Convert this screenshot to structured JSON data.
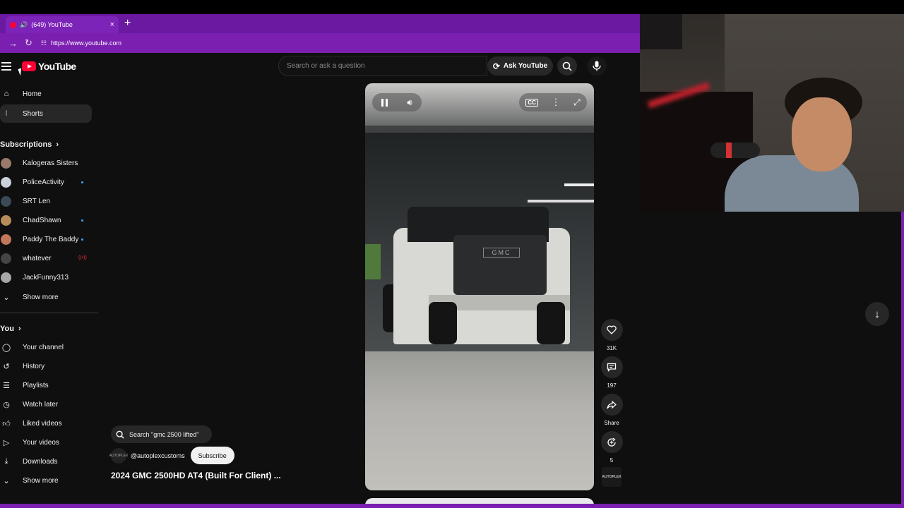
{
  "browser": {
    "tab_title": "(649) YouTube",
    "url": "https://www.youtube.com",
    "new_tab": "+",
    "close": "×"
  },
  "youtube": {
    "logo_text": "YouTube",
    "search": {
      "placeholder": "Search or ask a question"
    },
    "ask_label": "Ask YouTube"
  },
  "sidebar": {
    "main": [
      {
        "label": "Home",
        "icon": "home-icon"
      },
      {
        "label": "Shorts",
        "icon": "shorts-icon",
        "active": true
      }
    ],
    "subscriptions_title": "Subscriptions",
    "subscriptions": [
      {
        "label": "Kalogeras Sisters",
        "color": "#9a7a6a"
      },
      {
        "label": "PoliceActivity",
        "color": "#c9d1da",
        "dot": true
      },
      {
        "label": "SRT Len",
        "color": "#3b4a55"
      },
      {
        "label": "ChadShawn",
        "color": "#b58c5a",
        "dot": true
      },
      {
        "label": "Paddy The Baddy",
        "color": "#c2775c",
        "dot": true
      },
      {
        "label": "whatever",
        "color": "#444444",
        "live": "((•))"
      },
      {
        "label": "JackFunny313",
        "color": "#a7a7a7"
      }
    ],
    "show_more_1": "Show more",
    "you_title": "You",
    "you": [
      {
        "label": "Your channel",
        "icon": "your-channel-icon"
      },
      {
        "label": "History",
        "icon": "history-icon"
      },
      {
        "label": "Playlists",
        "icon": "playlists-icon"
      },
      {
        "label": "Watch later",
        "icon": "watch-later-icon"
      },
      {
        "label": "Liked videos",
        "icon": "liked-videos-icon"
      },
      {
        "label": "Your videos",
        "icon": "your-videos-icon"
      },
      {
        "label": "Downloads",
        "icon": "downloads-icon"
      }
    ],
    "show_more_2": "Show more"
  },
  "short": {
    "brand_on_truck": "GMC",
    "search_chip": "Search \"gmc 2500 lifted\"",
    "channel": "@autoplexcustoms",
    "channel_avatar_text": "AUTOPLEX",
    "subscribe_label": "Subscribe",
    "title": "2024 GMC 2500HD AT4 (Built For Client) ...",
    "likes": "31K",
    "comments": "197",
    "share_label": "Share",
    "remix_count": "5"
  },
  "colors": {
    "browser_accent": "#7a1fb0",
    "youtube_red": "#ff0033",
    "background": "#0f0f0f"
  }
}
